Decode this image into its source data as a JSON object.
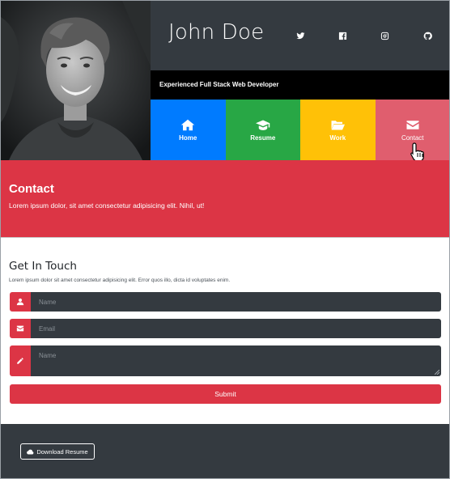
{
  "header": {
    "name": "John Doe",
    "tagline": "Experienced Full Stack Web Developer",
    "social": [
      "twitter-icon",
      "facebook-icon",
      "instagram-icon",
      "github-icon"
    ]
  },
  "nav": {
    "items": [
      {
        "label": "Home",
        "icon": "home-icon",
        "color": "#007bff"
      },
      {
        "label": "Resume",
        "icon": "graduation-cap-icon",
        "color": "#28a745"
      },
      {
        "label": "Work",
        "icon": "folder-open-icon",
        "color": "#ffc107"
      },
      {
        "label": "Contact",
        "icon": "envelope-icon",
        "color": "#e05e6e"
      }
    ]
  },
  "banner": {
    "title": "Contact",
    "text": "Lorem ipsum dolor, sit amet consectetur adipisicing elit. Nihil, ut!"
  },
  "form": {
    "heading": "Get In Touch",
    "lead": "Lorem ipsum dolor sit amet consectetur adipisicing elit. Error quos illo, dicta id voluptates enim.",
    "name_placeholder": "Name",
    "email_placeholder": "Email",
    "message_placeholder": "Name",
    "submit_label": "Submit"
  },
  "footer": {
    "download_label": "Download Resume"
  },
  "colors": {
    "accent": "#dc3545",
    "dark": "#343a40",
    "primary": "#007bff",
    "success": "#28a745",
    "warning": "#ffc107"
  }
}
